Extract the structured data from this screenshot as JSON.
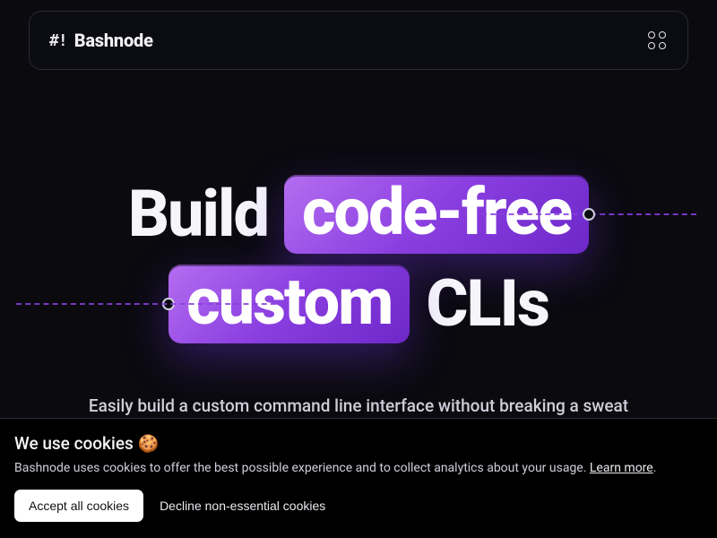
{
  "brand": {
    "mark": "#!",
    "name": "Bashnode"
  },
  "hero": {
    "line1": {
      "plain": "Build",
      "pill": "code-free"
    },
    "line2": {
      "pill": "custom",
      "plain": "CLIs"
    },
    "subhead": "Easily build a custom command line interface without breaking a sweat"
  },
  "cookies": {
    "title": "We use cookies 🍪",
    "body_pre": "Bashnode uses cookies to offer the best possible experience and to collect analytics about your usage. ",
    "learn_more": "Learn more",
    "body_post": ".",
    "accept": "Accept all cookies",
    "decline": "Decline non-essential cookies"
  }
}
